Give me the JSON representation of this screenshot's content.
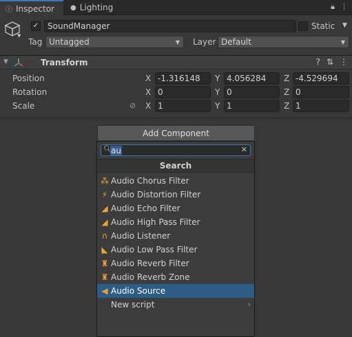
{
  "tabs": [
    {
      "label": "Inspector",
      "icon": "info-icon"
    },
    {
      "label": "Lighting",
      "icon": "bulb-icon"
    }
  ],
  "header": {
    "active": true,
    "name": "SoundManager",
    "static_label": "Static",
    "tag_label": "Tag",
    "tag_value": "Untagged",
    "layer_label": "Layer",
    "layer_value": "Default"
  },
  "transform": {
    "title": "Transform",
    "rows": [
      {
        "label": "Position",
        "x": "-1.316148",
        "y": "4.056284",
        "z": "-4.529694"
      },
      {
        "label": "Rotation",
        "x": "0",
        "y": "0",
        "z": "0"
      },
      {
        "label": "Scale",
        "x": "1",
        "y": "1",
        "z": "1"
      }
    ],
    "axis_x": "X",
    "axis_y": "Y",
    "axis_z": "Z"
  },
  "add_component": {
    "button_label": "Add Component",
    "search_value": "au",
    "search_title": "Search",
    "items": [
      {
        "label": "Audio Chorus Filter",
        "icon": "chorus-filter-icon",
        "glyph": "⁂"
      },
      {
        "label": "Audio Distortion Filter",
        "icon": "distortion-filter-icon",
        "glyph": "⚡"
      },
      {
        "label": "Audio Echo Filter",
        "icon": "echo-filter-icon",
        "glyph": "◢"
      },
      {
        "label": "Audio High Pass Filter",
        "icon": "high-pass-filter-icon",
        "glyph": "◢"
      },
      {
        "label": "Audio Listener",
        "icon": "headphones-icon",
        "glyph": "∩"
      },
      {
        "label": "Audio Low Pass Filter",
        "icon": "low-pass-filter-icon",
        "glyph": "◣"
      },
      {
        "label": "Audio Reverb Filter",
        "icon": "reverb-filter-icon",
        "glyph": "♜"
      },
      {
        "label": "Audio Reverb Zone",
        "icon": "reverb-zone-icon",
        "glyph": "♜"
      },
      {
        "label": "Audio Source",
        "icon": "speaker-icon",
        "glyph": "◀",
        "selected": true
      },
      {
        "label": "New script",
        "icon": "",
        "glyph": "",
        "submenu": true
      }
    ]
  },
  "colors": {
    "accent": "#3a79bb",
    "selection": "#2c5d87",
    "audio_icon": "#e7a23a"
  }
}
